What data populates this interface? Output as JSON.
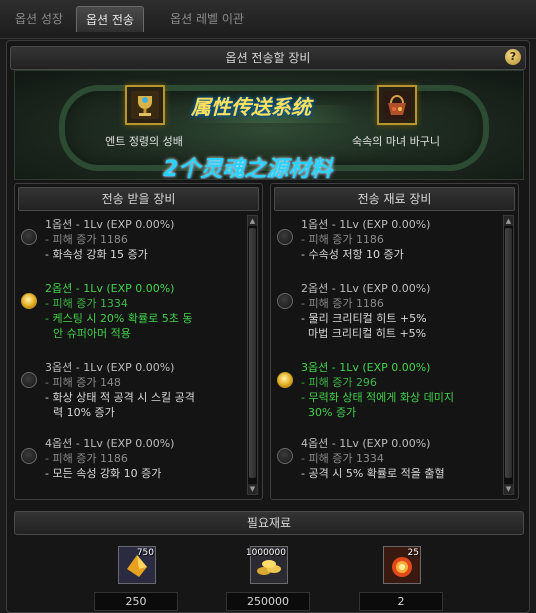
{
  "tabs": [
    {
      "label": "옵션 성장",
      "active": false
    },
    {
      "label": "옵션 전송",
      "active": true
    },
    {
      "label": "옵션 레벨 이관",
      "active": false
    }
  ],
  "header": {
    "title": "옵션 전송할 장비",
    "help_icon": "question-icon"
  },
  "banner": {
    "overlay_title": "属性传送系统",
    "overlay_subtitle": "2个灵魂之源材料",
    "source_item": {
      "name": "엔트 정령의 성배",
      "icon": "chalice-icon"
    },
    "target_item": {
      "name": "숙속의 마녀 바구니",
      "icon": "basket-icon"
    }
  },
  "left_panel": {
    "title": "전송 받을 장비",
    "options": [
      {
        "selected": false,
        "highlighted": false,
        "lines": [
          "1옵션 - 1Lv (EXP 0.00%)",
          "- 피해 증가 1186",
          "- 화속성 강화 15 증가"
        ]
      },
      {
        "selected": true,
        "highlighted": true,
        "lines": [
          "2옵션 - 1Lv (EXP 0.00%)",
          "- 피해 증가 1334",
          "- 케스팅 시 20% 확률로 5초 동",
          "안 슈퍼아머 적용"
        ]
      },
      {
        "selected": false,
        "highlighted": false,
        "lines": [
          "3옵션 - 1Lv (EXP 0.00%)",
          "- 피해 증가 148",
          "- 화상 상태 적 공격 시 스킬 공격",
          "력 10% 증가"
        ]
      },
      {
        "selected": false,
        "highlighted": false,
        "lines": [
          "4옵션 - 1Lv (EXP 0.00%)",
          "- 피해 증가 1186",
          "- 모든 속성 강화 10 증가"
        ]
      }
    ]
  },
  "right_panel": {
    "title": "전송 재료 장비",
    "options": [
      {
        "selected": false,
        "highlighted": false,
        "lines": [
          "1옵션 - 1Lv (EXP 0.00%)",
          "- 피해 증가 1186",
          "- 수속성 저항 10 증가"
        ]
      },
      {
        "selected": false,
        "highlighted": false,
        "lines": [
          "2옵션 - 1Lv (EXP 0.00%)",
          "- 피해 증가 1186",
          "- 물리 크리티컬 히트 +5%",
          "  마법 크리티컬 히트 +5%"
        ]
      },
      {
        "selected": true,
        "highlighted": true,
        "lines": [
          "3옵션 - 1Lv (EXP 0.00%)",
          "- 피해 증가 296",
          "- 무력화 상태 적에게 화상 데미지",
          "  30% 증가"
        ]
      },
      {
        "selected": false,
        "highlighted": false,
        "lines": [
          "4옵션 - 1Lv (EXP 0.00%)",
          "- 피해 증가 1334",
          "- 공격 시 5% 확률로 적을 출혈"
        ]
      }
    ]
  },
  "required": {
    "title": "필요재료",
    "materials": [
      {
        "icon": "gold-crystal-icon",
        "badge": "750",
        "value": "250"
      },
      {
        "icon": "gold-coins-icon",
        "badge": "1000000",
        "value": "250000"
      },
      {
        "icon": "fire-burst-icon",
        "badge": "25",
        "value": "2"
      }
    ]
  },
  "colors": {
    "highlight_green": "#41d24a",
    "overlay_yellow": "#ffe15a",
    "overlay_cyan": "#2ad3ff",
    "gold": "#b8962e"
  }
}
